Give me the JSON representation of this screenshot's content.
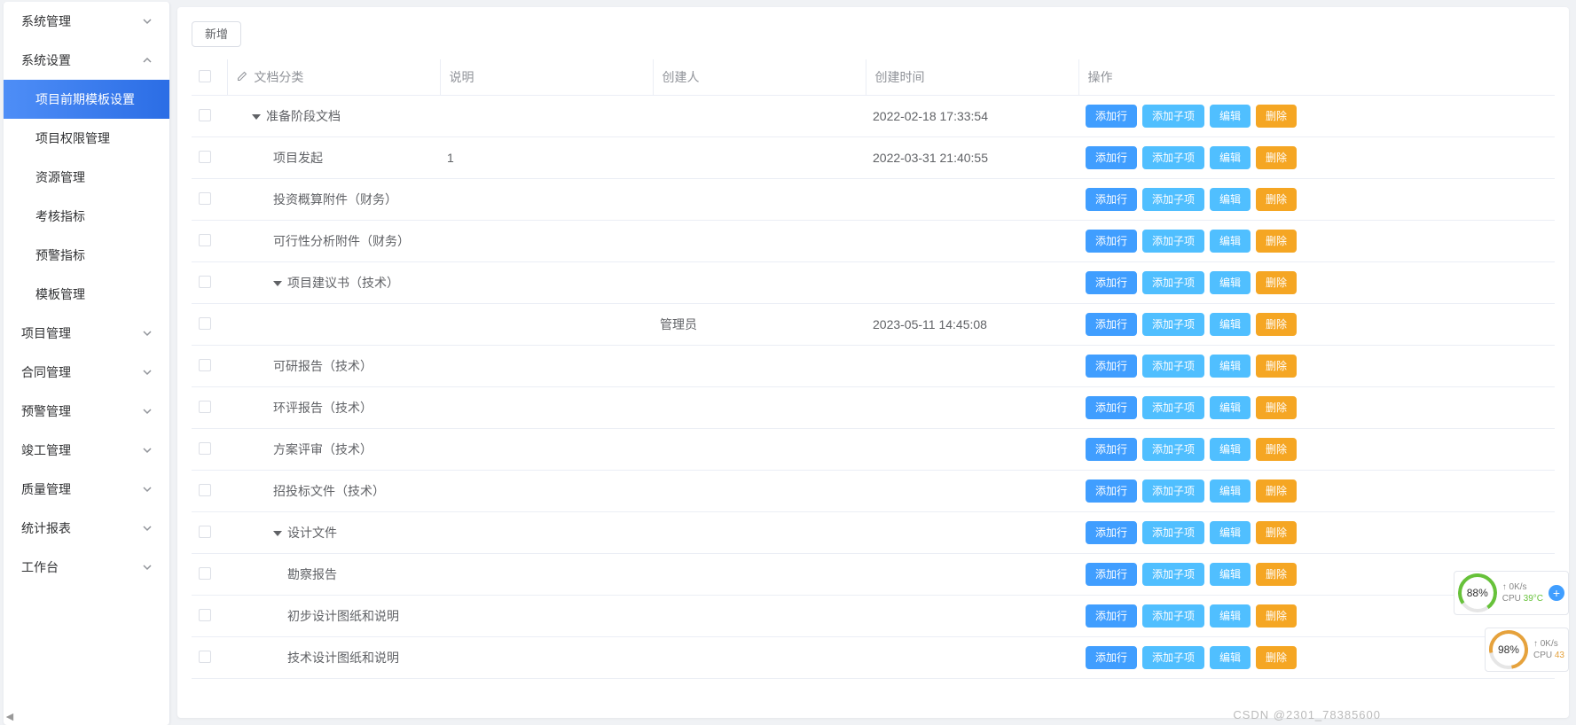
{
  "sidebar": {
    "groups": [
      {
        "label": "系统管理",
        "expanded": false,
        "items": []
      },
      {
        "label": "系统设置",
        "expanded": true,
        "items": [
          {
            "label": "项目前期模板设置",
            "active": true
          },
          {
            "label": "项目权限管理",
            "active": false
          },
          {
            "label": "资源管理",
            "active": false
          },
          {
            "label": "考核指标",
            "active": false
          },
          {
            "label": "预警指标",
            "active": false
          },
          {
            "label": "模板管理",
            "active": false
          }
        ]
      },
      {
        "label": "项目管理",
        "expanded": false,
        "items": []
      },
      {
        "label": "合同管理",
        "expanded": false,
        "items": []
      },
      {
        "label": "预警管理",
        "expanded": false,
        "items": []
      },
      {
        "label": "竣工管理",
        "expanded": false,
        "items": []
      },
      {
        "label": "质量管理",
        "expanded": false,
        "items": []
      },
      {
        "label": "统计报表",
        "expanded": false,
        "items": []
      },
      {
        "label": "工作台",
        "expanded": false,
        "items": []
      }
    ]
  },
  "toolbar": {
    "add_label": "新增"
  },
  "table": {
    "columns": {
      "category": "文档分类",
      "desc": "说明",
      "creator": "创建人",
      "created_at": "创建时间",
      "actions": "操作"
    },
    "action_labels": {
      "add_row": "添加行",
      "add_child": "添加子项",
      "edit": "编辑",
      "delete": "删除"
    },
    "rows": [
      {
        "name": "准备阶段文档",
        "desc": "",
        "creator": "",
        "created_at": "2022-02-18 17:33:54",
        "indent": 1,
        "expandable": true
      },
      {
        "name": "项目发起",
        "desc": "1",
        "creator": "",
        "created_at": "2022-03-31 21:40:55",
        "indent": 2,
        "expandable": false
      },
      {
        "name": "投资概算附件（财务）",
        "desc": "",
        "creator": "",
        "created_at": "",
        "indent": 2,
        "expandable": false
      },
      {
        "name": "可行性分析附件（财务）",
        "desc": "",
        "creator": "",
        "created_at": "",
        "indent": 2,
        "expandable": false
      },
      {
        "name": "项目建议书（技术）",
        "desc": "",
        "creator": "",
        "created_at": "",
        "indent": 2,
        "expandable": true
      },
      {
        "name": "",
        "desc": "",
        "creator": "管理员",
        "created_at": "2023-05-11 14:45:08",
        "indent": 2,
        "expandable": false
      },
      {
        "name": "可研报告（技术）",
        "desc": "",
        "creator": "",
        "created_at": "",
        "indent": 2,
        "expandable": false
      },
      {
        "name": "环评报告（技术）",
        "desc": "",
        "creator": "",
        "created_at": "",
        "indent": 2,
        "expandable": false
      },
      {
        "name": "方案评审（技术）",
        "desc": "",
        "creator": "",
        "created_at": "",
        "indent": 2,
        "expandable": false
      },
      {
        "name": "招投标文件（技术）",
        "desc": "",
        "creator": "",
        "created_at": "",
        "indent": 2,
        "expandable": false
      },
      {
        "name": "设计文件",
        "desc": "",
        "creator": "",
        "created_at": "",
        "indent": 2,
        "expandable": true
      },
      {
        "name": "勘察报告",
        "desc": "",
        "creator": "",
        "created_at": "",
        "indent": 3,
        "expandable": false
      },
      {
        "name": "初步设计图纸和说明",
        "desc": "",
        "creator": "",
        "created_at": "",
        "indent": 3,
        "expandable": false
      },
      {
        "name": "技术设计图纸和说明",
        "desc": "",
        "creator": "",
        "created_at": "",
        "indent": 3,
        "expandable": false
      }
    ]
  },
  "gauges": {
    "top": {
      "pct": "88%",
      "net": "0K/s",
      "cpu_label": "CPU",
      "cpu_val": "39°C"
    },
    "bottom": {
      "pct": "98%",
      "net": "0K/s",
      "cpu_label": "CPU",
      "cpu_val": "43"
    }
  },
  "watermark": "CSDN @2301_78385600"
}
